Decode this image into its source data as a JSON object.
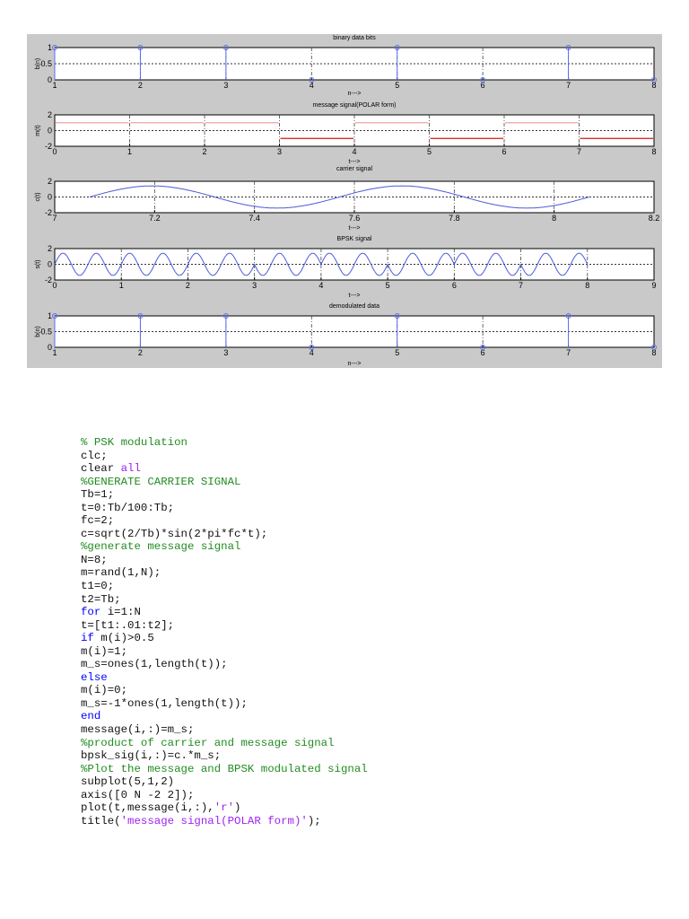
{
  "colors": {
    "figure_bg": "#c9c9c9",
    "stem": "#5a6cf0",
    "msg_pos": "#f0a0a0",
    "msg_neg": "#d01818",
    "wave": "#4a5ad8",
    "comment": "#228b22",
    "keyword": "#0000ff",
    "string": "#a020f0"
  },
  "chart_data": [
    {
      "type": "stem",
      "title": "binary data bits",
      "xlabel": "n--->",
      "ylabel": "b(n)",
      "xlim": [
        1,
        8
      ],
      "ylim": [
        0,
        1
      ],
      "xticks": [
        1,
        2,
        3,
        4,
        5,
        6,
        7,
        8
      ],
      "yticks": [
        "0",
        "0.5",
        "1"
      ],
      "x": [
        1,
        2,
        3,
        4,
        5,
        6,
        7,
        8
      ],
      "values": [
        1,
        1,
        1,
        0,
        1,
        0,
        1,
        0
      ]
    },
    {
      "type": "line",
      "title": "message signal(POLAR form)",
      "xlabel": "t--->",
      "ylabel": "m(t)",
      "xlim": [
        0,
        8
      ],
      "ylim": [
        -2,
        2
      ],
      "xticks": [
        0,
        1,
        2,
        3,
        4,
        5,
        6,
        7,
        8
      ],
      "yticks": [
        "-2",
        "0",
        "2"
      ],
      "bits": [
        1,
        1,
        1,
        0,
        1,
        0,
        1,
        0
      ],
      "levels": [
        1,
        -1
      ]
    },
    {
      "type": "line",
      "title": "carrier signal",
      "xlabel": "t--->",
      "ylabel": "c(t)",
      "xlim": [
        7,
        8.2
      ],
      "ylim": [
        -2,
        2
      ],
      "xticks": [
        "7",
        "7.2",
        "7.4",
        "7.6",
        "7.8",
        "8",
        "8.2"
      ],
      "yticks": [
        "-2",
        "0",
        "2"
      ],
      "amplitude": 1.414,
      "frequency": 2,
      "t_range": [
        7.07,
        8.07
      ]
    },
    {
      "type": "line",
      "title": "BPSK signal",
      "xlabel": "t--->",
      "ylabel": "s(t)",
      "xlim": [
        0,
        9
      ],
      "ylim": [
        -2,
        2
      ],
      "xticks": [
        0,
        1,
        2,
        3,
        4,
        5,
        6,
        7,
        8,
        9
      ],
      "yticks": [
        "-2",
        "0",
        "2"
      ],
      "amplitude": 1.414,
      "frequency": 2,
      "bits": [
        1,
        1,
        1,
        0,
        1,
        0,
        1,
        0
      ]
    },
    {
      "type": "stem",
      "title": "demodulated data",
      "xlabel": "n--->",
      "ylabel": "b(n)",
      "xlim": [
        1,
        8
      ],
      "ylim": [
        0,
        1
      ],
      "xticks": [
        1,
        2,
        3,
        4,
        5,
        6,
        7,
        8
      ],
      "yticks": [
        "0",
        "0.5",
        "1"
      ],
      "x": [
        1,
        2,
        3,
        4,
        5,
        6,
        7,
        8
      ],
      "values": [
        1,
        1,
        1,
        0,
        1,
        0,
        1,
        0
      ]
    }
  ],
  "code": [
    [
      [
        "comment",
        "% PSK modulation"
      ]
    ],
    [
      [
        "plain",
        "clc;"
      ]
    ],
    [
      [
        "plain",
        "clear "
      ],
      [
        "string",
        "all"
      ]
    ],
    [
      [
        "comment",
        "%GENERATE CARRIER SIGNAL"
      ]
    ],
    [
      [
        "plain",
        "Tb=1;"
      ]
    ],
    [
      [
        "plain",
        "t=0:Tb/100:Tb;"
      ]
    ],
    [
      [
        "plain",
        "fc=2;"
      ]
    ],
    [
      [
        "plain",
        "c=sqrt(2/Tb)*sin(2*pi*fc*t);"
      ]
    ],
    [
      [
        "comment",
        "%generate message signal"
      ]
    ],
    [
      [
        "plain",
        "N=8;"
      ]
    ],
    [
      [
        "plain",
        "m=rand(1,N);"
      ]
    ],
    [
      [
        "plain",
        "t1=0;"
      ]
    ],
    [
      [
        "plain",
        "t2=Tb;"
      ]
    ],
    [
      [
        "keyword",
        "for"
      ],
      [
        "plain",
        " i=1:N"
      ]
    ],
    [
      [
        "plain",
        "t=[t1:.01:t2];"
      ]
    ],
    [
      [
        "keyword",
        "if"
      ],
      [
        "plain",
        " m(i)>0.5"
      ]
    ],
    [
      [
        "plain",
        "m(i)=1;"
      ]
    ],
    [
      [
        "plain",
        "m_s=ones(1,length(t));"
      ]
    ],
    [
      [
        "keyword",
        "else"
      ]
    ],
    [
      [
        "plain",
        "m(i)=0;"
      ]
    ],
    [
      [
        "plain",
        "m_s=-1*ones(1,length(t));"
      ]
    ],
    [
      [
        "keyword",
        "end"
      ]
    ],
    [
      [
        "plain",
        "message(i,:)=m_s;"
      ]
    ],
    [
      [
        "comment",
        "%product of carrier and message signal"
      ]
    ],
    [
      [
        "plain",
        "bpsk_sig(i,:)=c.*m_s;"
      ]
    ],
    [
      [
        "comment",
        "%Plot the message and BPSK modulated signal"
      ]
    ],
    [
      [
        "plain",
        "subplot(5,1,2)"
      ]
    ],
    [
      [
        "plain",
        "axis([0 N -2 2]);"
      ]
    ],
    [
      [
        "plain",
        "plot(t,message(i,:),"
      ],
      [
        "string",
        "'r'"
      ],
      [
        "plain",
        ")"
      ]
    ],
    [
      [
        "plain",
        "title("
      ],
      [
        "string",
        "'message signal(POLAR form)'"
      ],
      [
        "plain",
        ");"
      ]
    ]
  ]
}
